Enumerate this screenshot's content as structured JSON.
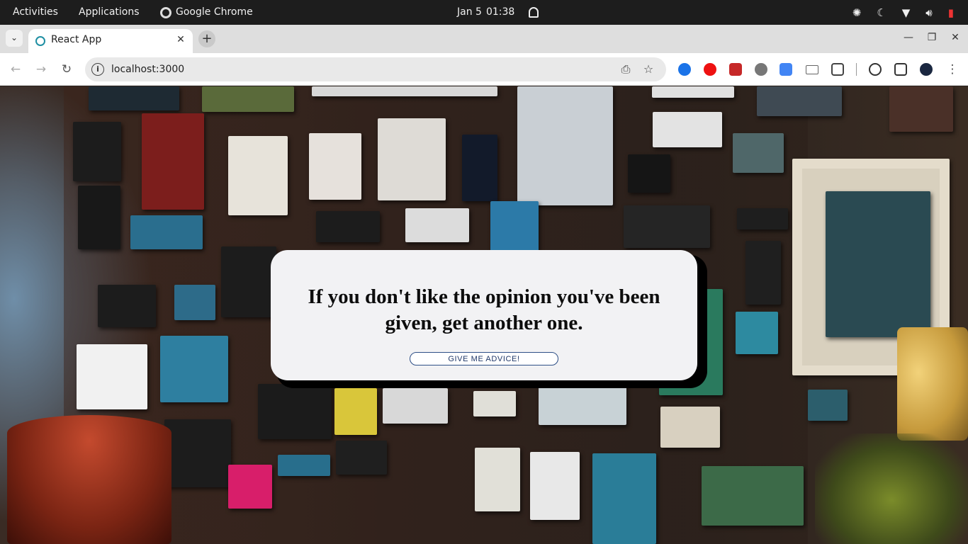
{
  "system_bar": {
    "activities": "Activities",
    "applications": "Applications",
    "app_name": "Google Chrome",
    "date": "Jan 5",
    "time": "01:38",
    "icons": [
      "settings-icon",
      "night-mode-icon",
      "wifi-icon",
      "volume-icon",
      "battery-icon"
    ]
  },
  "browser": {
    "tab_title": "React App",
    "url": "localhost:3000",
    "extensions": [
      "extension-blue-icon",
      "opera-icon",
      "extension-red-icon",
      "wordpress-icon",
      "translate-icon",
      "mail-icon",
      "puzzle-icon"
    ]
  },
  "advice_card": {
    "quote": "If you don't like the opinion you've been given, get another one.",
    "button_label": "GIVE ME ADVICE!"
  },
  "colors": {
    "card_background": "#f2f2f4",
    "card_shadow": "#000000",
    "button_border": "#2e4f86",
    "page_background": "#2b231f"
  }
}
